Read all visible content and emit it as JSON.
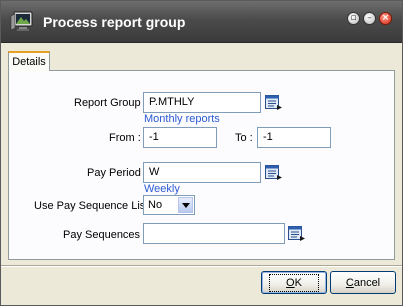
{
  "window": {
    "title": "Process report group"
  },
  "tabs": [
    {
      "label": "Details"
    }
  ],
  "form": {
    "report_group": {
      "label": "Report Group :",
      "value": "P.MTHLY",
      "hint": "Monthly reports"
    },
    "from": {
      "label": "From :",
      "value": "-1"
    },
    "to": {
      "label": "To :",
      "value": "-1"
    },
    "pay_period": {
      "label": "Pay Period :",
      "value": "W",
      "hint": "Weekly"
    },
    "use_pay_sequence_list": {
      "label": "Use Pay Sequence List :",
      "value": "No"
    },
    "pay_sequences": {
      "label": "Pay Sequences :",
      "value": ""
    }
  },
  "buttons": {
    "ok_mnemonic": "O",
    "ok_rest": "K",
    "cancel_mnemonic": "C",
    "cancel_rest": "ancel"
  },
  "colors": {
    "hint": "#2c5bd4",
    "tab_accent": "#e6a024",
    "title_bar": "#4b4b4b"
  },
  "icons": {
    "app": "monitor-app-icon",
    "lookup": "lookup-list-icon",
    "restore": "restore-icon",
    "minimize": "minimize-icon",
    "close": "close-icon"
  }
}
